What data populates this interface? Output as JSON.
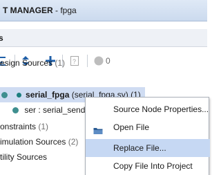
{
  "window": {
    "title_strong": "T MANAGER",
    "title_rest": " - fpga"
  },
  "panel": {
    "title": "s"
  },
  "toolbar": {
    "collapse_all_icon": "collapse-all-icon",
    "expand_all_icon": "expand-all-icon",
    "add_sources_icon": "plus-icon",
    "properties_icon": "doc-icon",
    "messages_count": "0"
  },
  "tree": {
    "design_sources": "esign Sources",
    "design_sources_count": " (1)",
    "top_file_name": "serial_fpga",
    "top_file_detail": " (serial_fpga.sv) (1)",
    "child_instance": "ser : serial_send",
    "constraints": "onstraints",
    "constraints_count": " (1)",
    "simulation_sources": "imulation Sources",
    "simulation_sources_count": " (2)",
    "utility_sources": "tility Sources"
  },
  "context_menu": {
    "items": [
      {
        "label": "Source Node Properties..."
      },
      {
        "label": "Open File"
      },
      {
        "label": "Replace File..."
      },
      {
        "label": "Copy File Into Project"
      }
    ],
    "highlighted_index": 2
  },
  "colors": {
    "title_bar": "#cbdaee",
    "selection": "#cfdcf2",
    "menu_highlight": "#c6d8f3",
    "toolbar_icon": "#1f5fa8",
    "source_dot": "#3f8f8f"
  }
}
